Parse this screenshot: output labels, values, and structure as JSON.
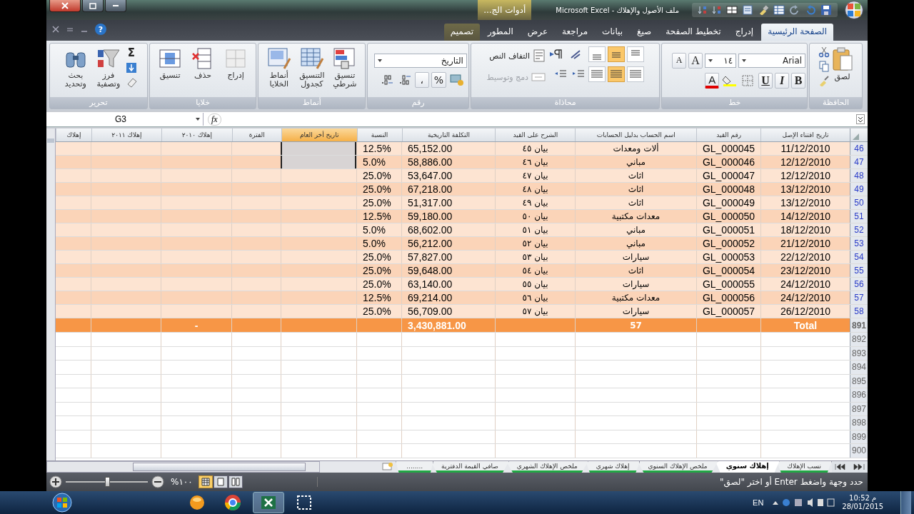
{
  "title_bar": {
    "context_tab": "أدوات الج...",
    "title": "ملف الأصول والإهلاك - Microsoft Excel"
  },
  "help": "?",
  "ribbon_tabs": [
    {
      "label": "الصفحة الرئيسية",
      "selected": true,
      "context": false
    },
    {
      "label": "إدراج",
      "selected": false,
      "context": false
    },
    {
      "label": "تخطيط الصفحة",
      "selected": false,
      "context": false
    },
    {
      "label": "صيغ",
      "selected": false,
      "context": false
    },
    {
      "label": "بيانات",
      "selected": false,
      "context": false
    },
    {
      "label": "مراجعة",
      "selected": false,
      "context": false
    },
    {
      "label": "عرض",
      "selected": false,
      "context": false
    },
    {
      "label": "المطور",
      "selected": false,
      "context": false
    },
    {
      "label": "تصميم",
      "selected": false,
      "context": true
    }
  ],
  "clipboard": {
    "title": "الحافظة",
    "paste": "لصق"
  },
  "font": {
    "title": "خط",
    "name": "Arial",
    "size": "١٤",
    "grow": "A",
    "shrink": "A",
    "bold": "B",
    "italic": "I",
    "underline": "U",
    "color_letter": "A"
  },
  "alignment": {
    "title": "محاذاة",
    "vertical": [
      {
        "selected": false
      },
      {
        "selected": true
      },
      {
        "selected": false
      }
    ],
    "horizontal": [
      {
        "selected": false
      },
      {
        "selected": true
      },
      {
        "selected": false
      }
    ],
    "wrap": {
      "label": "التفاف النص",
      "disabled": false
    },
    "merge": {
      "label": "دمج وتوسيط",
      "disabled": true
    }
  },
  "number": {
    "title": "رقم",
    "format": "التاريخ",
    "percent": "%",
    "comma": "،"
  },
  "styles": {
    "title": "أنماط",
    "buttons": [
      {
        "kind": "conditional",
        "label": "تنسيق شرطي"
      },
      {
        "kind": "table",
        "label": "التنسيق كجدول"
      },
      {
        "kind": "cell_styles",
        "label": "أنماط الخلايا"
      }
    ]
  },
  "cells": {
    "title": "خلايا",
    "buttons": [
      {
        "kind": "insert",
        "label": "إدراج"
      },
      {
        "kind": "delete",
        "label": "حذف"
      },
      {
        "kind": "format",
        "label": "تنسيق"
      }
    ]
  },
  "editing": {
    "title": "تحرير",
    "sum": "Σ",
    "buttons": [
      {
        "kind": "sort",
        "label": "فرز وتصفية"
      },
      {
        "kind": "find",
        "label": "بحث وتحديد"
      }
    ]
  },
  "formula_bar": {
    "name_box": "G3",
    "fx": "fx"
  },
  "columns": [
    {
      "label": "تاريخ اقتناء الإصل",
      "selected": false
    },
    {
      "label": "رقم القيد",
      "selected": false
    },
    {
      "label": "اسم الحساب بدليل الحسابات",
      "selected": false
    },
    {
      "label": "الشرح على القيد",
      "selected": false
    },
    {
      "label": "التكلفة التاريخية",
      "selected": false
    },
    {
      "label": "النسبة",
      "selected": false
    },
    {
      "label": "تاريخ أخر العام",
      "selected": true
    },
    {
      "label": "الفترة",
      "selected": false
    },
    {
      "label": "إهلاك ٢٠١٠",
      "selected": false
    },
    {
      "label": "إهلاك ٢٠١١",
      "selected": false
    },
    {
      "label": "إهلاك",
      "selected": false
    }
  ],
  "rows": [
    {
      "kind": "data",
      "number": "46",
      "selected": true,
      "date": "11/12/2010",
      "code": "GL_000045",
      "account": "ألات ومعدات",
      "description": "بيان ٤٥",
      "cost": "65,152.00",
      "rate": "12.5%"
    },
    {
      "kind": "data",
      "number": "47",
      "selected": true,
      "date": "12/12/2010",
      "code": "GL_000046",
      "account": "مباني",
      "description": "بيان ٤٦",
      "cost": "58,886.00",
      "rate": "5.0%"
    },
    {
      "kind": "data",
      "number": "48",
      "selected": false,
      "date": "12/12/2010",
      "code": "GL_000047",
      "account": "اثاث",
      "description": "بيان ٤٧",
      "cost": "53,647.00",
      "rate": "25.0%"
    },
    {
      "kind": "data",
      "number": "49",
      "selected": false,
      "date": "13/12/2010",
      "code": "GL_000048",
      "account": "اثاث",
      "description": "بيان ٤٨",
      "cost": "67,218.00",
      "rate": "25.0%"
    },
    {
      "kind": "data",
      "number": "50",
      "selected": false,
      "date": "13/12/2010",
      "code": "GL_000049",
      "account": "اثاث",
      "description": "بيان ٤٩",
      "cost": "51,317.00",
      "rate": "25.0%"
    },
    {
      "kind": "data",
      "number": "51",
      "selected": false,
      "date": "14/12/2010",
      "code": "GL_000050",
      "account": "معدات مكتبية",
      "description": "بيان ٥٠",
      "cost": "59,180.00",
      "rate": "12.5%"
    },
    {
      "kind": "data",
      "number": "52",
      "selected": false,
      "date": "18/12/2010",
      "code": "GL_000051",
      "account": "مباني",
      "description": "بيان ٥١",
      "cost": "68,602.00",
      "rate": "5.0%"
    },
    {
      "kind": "data",
      "number": "53",
      "selected": false,
      "date": "21/12/2010",
      "code": "GL_000052",
      "account": "مباني",
      "description": "بيان ٥٢",
      "cost": "56,212.00",
      "rate": "5.0%"
    },
    {
      "kind": "data",
      "number": "54",
      "selected": false,
      "date": "22/12/2010",
      "code": "GL_000053",
      "account": "سيارات",
      "description": "بيان ٥٣",
      "cost": "57,827.00",
      "rate": "25.0%"
    },
    {
      "kind": "data",
      "number": "55",
      "selected": false,
      "date": "23/12/2010",
      "code": "GL_000054",
      "account": "اثاث",
      "description": "بيان ٥٤",
      "cost": "59,648.00",
      "rate": "25.0%"
    },
    {
      "kind": "data",
      "number": "56",
      "selected": false,
      "date": "24/12/2010",
      "code": "GL_000055",
      "account": "سيارات",
      "description": "بيان ٥٥",
      "cost": "63,140.00",
      "rate": "25.0%"
    },
    {
      "kind": "data",
      "number": "57",
      "selected": false,
      "date": "24/12/2010",
      "code": "GL_000056",
      "account": "معدات مكتبية",
      "description": "بيان ٥٦",
      "cost": "69,214.00",
      "rate": "12.5%"
    },
    {
      "kind": "data",
      "number": "58",
      "selected": false,
      "date": "26/12/2010",
      "code": "GL_000057",
      "account": "سيارات",
      "description": "بيان ٥٧",
      "cost": "56,709.00",
      "rate": "25.0%"
    },
    {
      "kind": "total",
      "number": "891",
      "selected": false,
      "date": "Total",
      "account": "57",
      "cost": "3,430,881.00",
      "dep_2010": "-"
    },
    {
      "kind": "empty",
      "number": "892",
      "selected": false
    },
    {
      "kind": "empty",
      "number": "893",
      "selected": false
    },
    {
      "kind": "empty",
      "number": "894",
      "selected": false
    },
    {
      "kind": "empty",
      "number": "895",
      "selected": false
    },
    {
      "kind": "empty",
      "number": "896",
      "selected": false
    },
    {
      "kind": "empty",
      "number": "897",
      "selected": false
    },
    {
      "kind": "empty",
      "number": "898",
      "selected": false
    },
    {
      "kind": "empty",
      "number": "899",
      "selected": false
    },
    {
      "kind": "empty",
      "number": "900",
      "selected": false
    }
  ],
  "sheet_tabs": [
    {
      "label": "نسب الإهلاك",
      "selected": false
    },
    {
      "label": "إهلاك سنوي",
      "selected": true
    },
    {
      "label": "ملخص الإهلاك السنوي",
      "selected": false
    },
    {
      "label": "إهلاك شهري",
      "selected": false
    },
    {
      "label": "ملخص الإهلاك الشهري",
      "selected": false
    },
    {
      "label": "صافي القيمة الدفترية",
      "selected": false
    },
    {
      "label": "........",
      "selected": false
    }
  ],
  "status_bar": {
    "message": "حدد وجهة واضغط Enter أو اختر \"لصق\"",
    "zoom": "%١٠٠",
    "zoom_slider": {
      "level": 0.5
    },
    "views": [
      {
        "kind": "normal",
        "selected": true
      },
      {
        "kind": "layout",
        "selected": false
      },
      {
        "kind": "break",
        "selected": false
      }
    ]
  },
  "taskbar": {
    "apps": [
      {
        "kind": "player",
        "selected": false
      },
      {
        "kind": "browser",
        "selected": false
      },
      {
        "kind": "spreadsheet",
        "selected": true
      },
      {
        "kind": "capture",
        "selected": false
      }
    ],
    "language": "EN",
    "time": "10:52 م",
    "date": "28/01/2015"
  }
}
